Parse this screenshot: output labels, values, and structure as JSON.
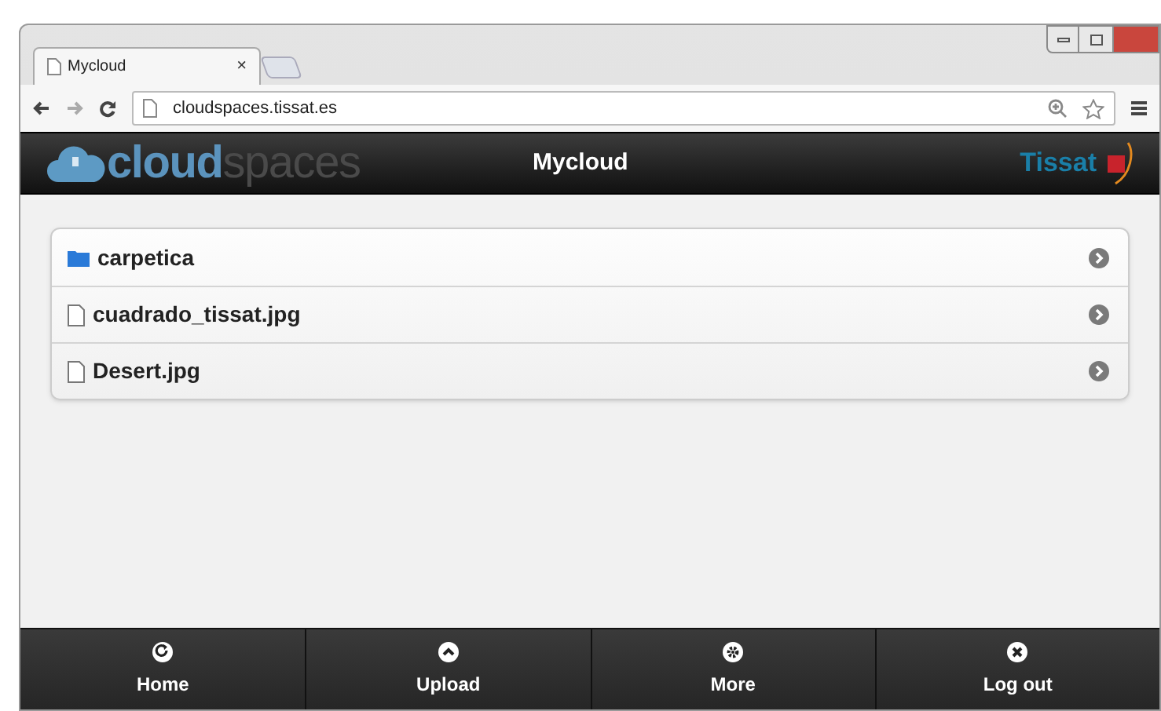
{
  "browser": {
    "tab_title": "Mycloud",
    "tab_close": "×",
    "url": "cloudspaces.tissat.es"
  },
  "header": {
    "logo_bold": "cloud",
    "logo_light": "spaces",
    "title": "Mycloud",
    "brand": "Tissat"
  },
  "items": [
    {
      "kind": "folder",
      "name": "carpetica"
    },
    {
      "kind": "file",
      "name": "cuadrado_tissat.jpg"
    },
    {
      "kind": "file",
      "name": "Desert.jpg"
    }
  ],
  "footer": [
    {
      "kind": "home",
      "label": "Home"
    },
    {
      "kind": "upload",
      "label": "Upload"
    },
    {
      "kind": "more",
      "label": "More"
    },
    {
      "kind": "logout",
      "label": "Log out"
    }
  ]
}
